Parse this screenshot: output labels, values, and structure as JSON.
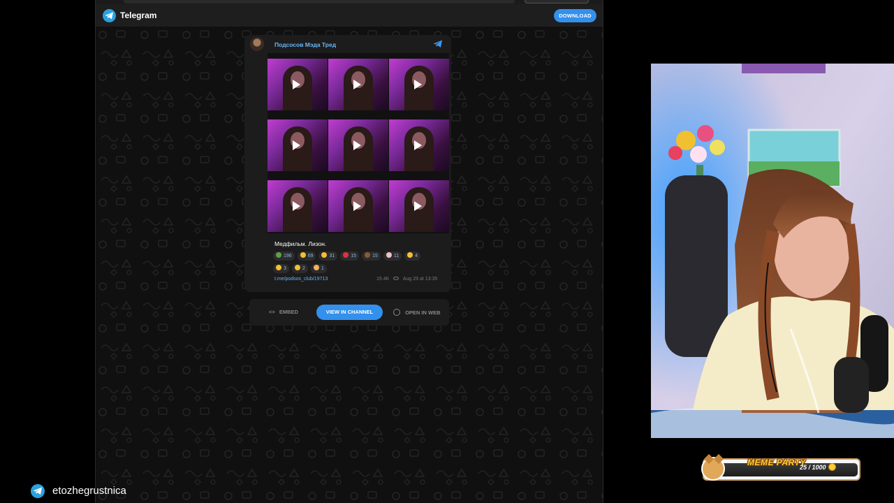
{
  "telegram": {
    "title": "Telegram",
    "download_label": "DOWNLOAD"
  },
  "post": {
    "channel_name": "Подсосов Мэда Тред",
    "text": "Медфильм. Лизон.",
    "reactions_row1": [
      {
        "icon": "nauseated-emoji",
        "count": "196",
        "color": "#5fa040"
      },
      {
        "icon": "grin-emoji",
        "count": "69",
        "color": "#f4c030"
      },
      {
        "icon": "smile-emoji",
        "count": "31",
        "color": "#f4c030"
      },
      {
        "icon": "heart-emoji",
        "count": "15",
        "color": "#e03040"
      },
      {
        "icon": "poop-emoji",
        "count": "15",
        "color": "#8a5a30"
      },
      {
        "icon": "clown-emoji",
        "count": "11",
        "color": "#f0c0c0"
      },
      {
        "icon": "thinking-emoji",
        "count": "4",
        "color": "#f4c030"
      }
    ],
    "reactions_row2": [
      {
        "icon": "scream-emoji",
        "count": "3",
        "color": "#f4c030"
      },
      {
        "icon": "laugh-emoji",
        "count": "2",
        "color": "#f4c030"
      },
      {
        "icon": "pray-emoji",
        "count": "1",
        "color": "#f4b060"
      }
    ],
    "link": "t.me/podsos_club/19713",
    "views": "15.4K",
    "date": "Aug 29 at 13:35"
  },
  "actions": {
    "embed_label": "EMBED",
    "view_label": "VIEW IN CHANNEL",
    "web_label": "OPEN IN WEB"
  },
  "overlay": {
    "meme_party_title": "MEME PARTY",
    "meme_party_progress": "25 / 1000",
    "social_handle": "etozhegrustnica"
  },
  "colors": {
    "telegram_blue": "#3390ec",
    "link_blue": "#6ab7f2",
    "background": "#000000"
  }
}
